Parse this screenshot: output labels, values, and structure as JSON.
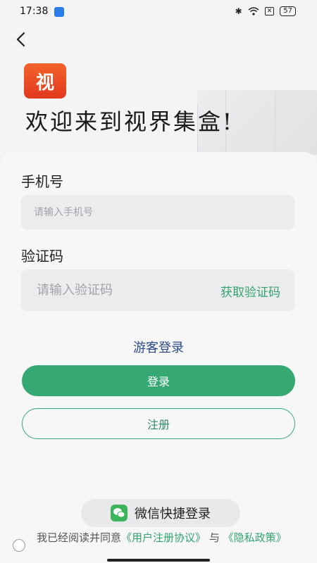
{
  "status_bar": {
    "time": "17:38",
    "battery": "57"
  },
  "header": {
    "logo_text": "视",
    "welcome": "欢迎来到视界集盒!"
  },
  "form": {
    "phone_label": "手机号",
    "phone_placeholder": "请输入手机号",
    "code_label": "验证码",
    "code_placeholder": "请输入验证码",
    "get_code": "获取验证码"
  },
  "actions": {
    "guest_login": "游客登录",
    "login": "登录",
    "register": "注册",
    "wechat_login": "微信快捷登录"
  },
  "agreement": {
    "prefix": "我已经阅读并同意",
    "user_agreement": "《用户注册协议》",
    "and": "与",
    "privacy_policy": "《隐私政策》"
  },
  "colors": {
    "accent": "#35a874",
    "link": "#2a4a86",
    "logo": "#e2381f"
  }
}
